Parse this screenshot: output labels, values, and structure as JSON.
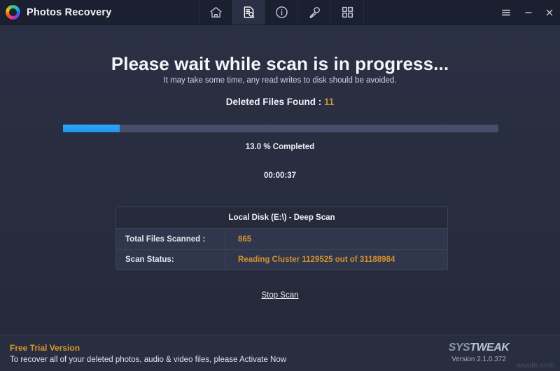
{
  "window": {
    "app_title": "Photos Recovery",
    "logo_icon": "photos-recovery-logo",
    "nav_tabs": [
      {
        "id": "home",
        "icon": "home-icon",
        "active": false
      },
      {
        "id": "scan",
        "icon": "document-search-icon",
        "active": true
      },
      {
        "id": "info",
        "icon": "info-circle-icon",
        "active": false
      },
      {
        "id": "register",
        "icon": "key-icon",
        "active": false
      },
      {
        "id": "apps",
        "icon": "grid-apps-icon",
        "active": false
      }
    ],
    "controls": [
      {
        "id": "menu",
        "icon": "hamburger-menu-icon"
      },
      {
        "id": "minimize",
        "icon": "minimize-icon"
      },
      {
        "id": "close",
        "icon": "close-icon"
      }
    ]
  },
  "scan": {
    "headline": "Please wait while scan is in progress...",
    "subline": "It may take some time, any read writes to disk should be avoided.",
    "found_label": "Deleted Files Found :",
    "found_count": "11",
    "progress_percent": 13.0,
    "percent_text": "13.0 % Completed",
    "elapsed_time": "00:00:37",
    "stop_scan_label": "Stop Scan"
  },
  "info_table": {
    "header": "Local Disk (E:\\) - Deep Scan",
    "rows": [
      {
        "label": "Total Files Scanned :",
        "value": "865"
      },
      {
        "label": "Scan Status:",
        "value": "Reading Cluster 1129525 out of 31188984"
      }
    ]
  },
  "footer": {
    "trial_title": "Free Trial Version",
    "trial_message": "To recover all of your deleted photos, audio & video files, please Activate Now",
    "brand_prefix": "SYS",
    "brand_suffix": "TWEAK",
    "version": "Version 2.1.0.372",
    "watermark": "wsxdn.com"
  },
  "colors": {
    "accent_amber": "#d2912e",
    "progress_blue": "#1d93ef",
    "header_bg": "#1b2030",
    "body_bg": "#2a2f42"
  }
}
